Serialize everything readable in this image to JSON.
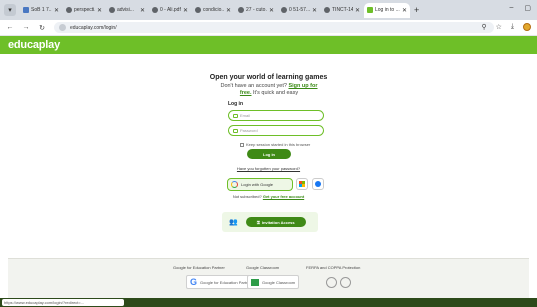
{
  "browser": {
    "tabs": [
      {
        "label": "SoB 1 7..."
      },
      {
        "label": "perspecti..."
      },
      {
        "label": "advisi..."
      },
      {
        "label": "0 - Ali.pdf"
      },
      {
        "label": "condicio..."
      },
      {
        "label": "27 - cuto..."
      },
      {
        "label": "0 51-57..."
      },
      {
        "label": "TINCT-141..."
      },
      {
        "label": "Log in to ..."
      }
    ],
    "url": "educaplay.com/login/"
  },
  "header": {
    "logo": "educaplay"
  },
  "login": {
    "title": "Open your world of learning games",
    "subtitle_pre": "Don't have an account yet?",
    "signup_link": "Sign up for free.",
    "subtitle_post": "It's quick and easy",
    "section_label": "Log in",
    "email_placeholder": "Email",
    "password_placeholder": "Password",
    "keep_session": "Keep session started in this browser",
    "login_button": "Log in",
    "forgot": "Have you forgotten your password?",
    "google_button": "Login with Google",
    "no_account_pre": "Not subscribed?",
    "no_account_link": "Get your free account",
    "invitation_button": "Invitation Access"
  },
  "footer": {
    "col1_title": "Google for Education Partner",
    "col1_badge": "Google for Education Partner",
    "col2_title": "Google Classroom",
    "col2_badge": "Google Classroom",
    "col3_title": "FERPA and COPPA Protection"
  },
  "status": {
    "text": "https://www.educaplay.com/login/?redirect=..."
  },
  "colors": {
    "brand_green": "#6ebf28",
    "dark_green": "#3f8a16"
  }
}
